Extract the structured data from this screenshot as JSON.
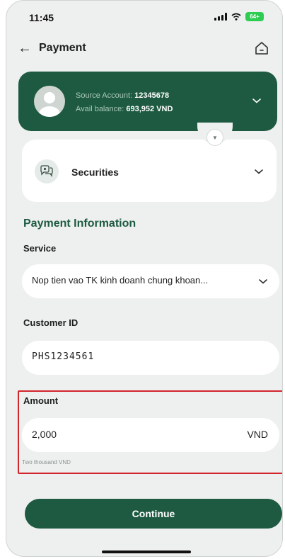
{
  "status_bar": {
    "time": "11:45",
    "battery": "64+"
  },
  "header": {
    "title": "Payment"
  },
  "account": {
    "source_label": "Source Account:",
    "source_number": "12345678",
    "balance_label": "Avail balance:",
    "balance_value": "693,952 VND"
  },
  "product": {
    "label": "Securities"
  },
  "payment_info": {
    "title": "Payment Information",
    "service_label": "Service",
    "service_value": "Nop tien vao TK kinh doanh chung khoan...",
    "customer_id_label": "Customer ID",
    "customer_id_value": "PHS1234561",
    "amount_label": "Amount",
    "amount_value": "2,000",
    "amount_currency": "VND",
    "amount_words": "Two thousand VND"
  },
  "actions": {
    "continue_label": "Continue"
  },
  "colors": {
    "brand": "#1e5a42",
    "highlight": "#d2252b",
    "background": "#eef0ef"
  }
}
